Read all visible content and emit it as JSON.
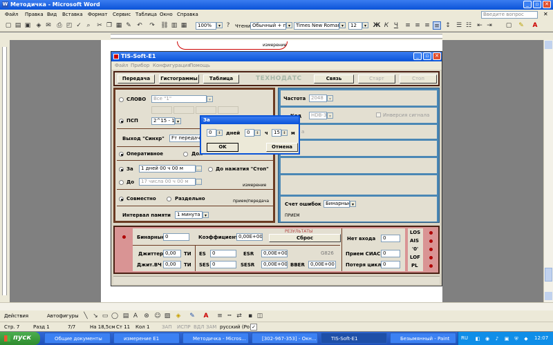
{
  "word": {
    "title": "Методичка - Microsoft Word",
    "menu": [
      "Файл",
      "Правка",
      "Вид",
      "Вставка",
      "Формат",
      "Сервис",
      "Таблица",
      "Окно",
      "Справка"
    ],
    "help_placeholder": "Введите вопрос",
    "zoom": "100%",
    "zoom_secondary": "Чтение",
    "style": "Обычный + по ц",
    "font": "Times New Roman",
    "size": "12",
    "draw_label": "Действия",
    "autoshapes_label": "Автофигуры",
    "doc_snippet": "измерение",
    "status": {
      "page": "Стр. 7",
      "section": "Разд 1",
      "pages": "7/7",
      "at": "На 18,5см",
      "line": "Ст 11",
      "col": "Кол 1",
      "rec": "ЗАП",
      "trk": "ИСПР",
      "ext": "ВДЛ",
      "ovr": "ЗАМ",
      "lang": "русский (Ро"
    }
  },
  "app": {
    "title": "TIS-Soft-E1",
    "menu": [
      "Файл",
      "Прибор",
      "Конфигурация",
      "Помощь"
    ],
    "toolbar": {
      "transfer": "Передача",
      "histograms": "Гистограммы",
      "table": "Таблица",
      "brand": "ТЕХНОДАТС",
      "link": "Связь",
      "start": "Старт",
      "stop": "Стоп"
    },
    "left": {
      "word_label": "СЛОВО",
      "word_value": "Все \"1\"",
      "psp_label": "ПСП",
      "psp_value": "2^15 - 1",
      "sync_label": "Выход \"Синхр\"",
      "sync_value": "Fт передачи",
      "operative": "Оперативное",
      "long_prefix": "Дол",
      "for_label": "За",
      "for_value": "1 дней 00 ч 00 м",
      "until_stop": "До нажатия \"Стоп\"",
      "to_label": "До",
      "to_value": "17 числа 00 ч 00 м",
      "measurement": "измерение",
      "joint": "Совместно",
      "separate": "Раздельно",
      "recv_send": "прием/передача",
      "memory_label": "Интервал памяти",
      "memory_value": "1 минута"
    },
    "right": {
      "freq_label": "Частота",
      "freq_value": "2048",
      "code_label": "Код",
      "code_value": "HDB-3",
      "invert_label": "Инверсия сигнала",
      "ca_fragment": "а",
      "err_label": "Счет ошибок",
      "err_value": "Бинарные",
      "recv": "ПРИЕМ"
    },
    "results": {
      "binary_label": "Бинарные",
      "binary_value": "0",
      "coef_label": "Коэффициент",
      "coef_value": "0,00E+00",
      "header": "РЕЗУЛЬТАТЫ",
      "reset": "Сброс",
      "no_input_label": "Нет входа",
      "no_input_value": "0",
      "ais_recv_label": "Прием СИАС",
      "ais_recv_value": "0",
      "cycle_loss_label": "Потеря цикла",
      "cycle_loss_value": "0",
      "jitter_label": "Джиттер",
      "jitter_value": "0,00",
      "jitter_unit": "ТИ",
      "jitter_hf_label": "Джит.ВЧ",
      "jitter_hf_value": "0,00",
      "jitter_hf_unit": "ТИ",
      "es_label": "ES",
      "es_value": "0",
      "esr_label": "ESR",
      "esr_value": "0,00E+00",
      "g826": "G826",
      "ses_label": "SES",
      "ses_value": "0",
      "sesr_label": "SESR",
      "sesr_value": "0,00E+00",
      "bber_label": "BBER",
      "bber_value": "0,00E+00",
      "alarms": [
        "LOS",
        "AIS",
        "'0'",
        "LOF",
        "PL"
      ]
    }
  },
  "dialog": {
    "title": "За",
    "days_value": "0",
    "days_label": "дней",
    "hours_value": "0",
    "hours_label": "ч",
    "minutes_value": "15",
    "minutes_label": "м",
    "ok": "OK",
    "cancel": "Отмена"
  },
  "taskbar": {
    "start": "пуск",
    "items": [
      "Общие документы",
      "измерение E1",
      "Методичка - Micros...",
      "[302-967-353] - Окн...",
      "TIS-Soft-E1",
      "Безымянный - Paint"
    ],
    "lang": "RU",
    "time": "12:07"
  }
}
